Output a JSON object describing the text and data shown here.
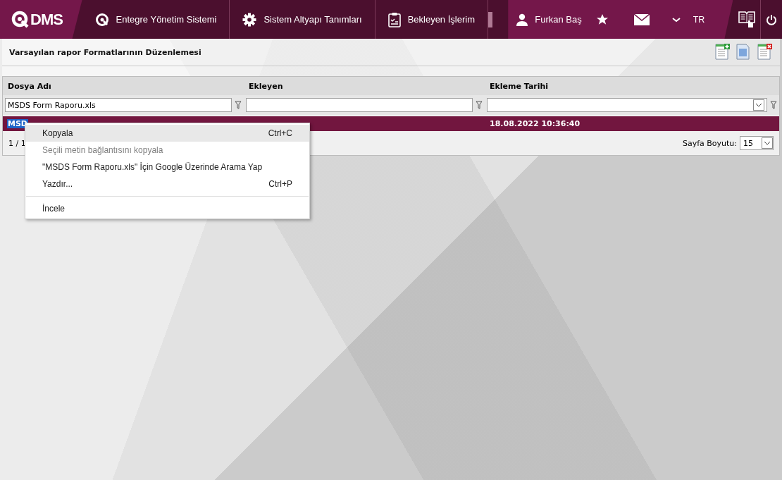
{
  "nav": {
    "logo": "DMS",
    "items": [
      {
        "label": "Entegre Yönetim Sistemi"
      },
      {
        "label": "Sistem Altyapı Tanımları"
      },
      {
        "label": "Bekleyen İşlerim"
      }
    ],
    "user": "Furkan Baş",
    "language": "TR"
  },
  "page": {
    "title": "Varsayılan rapor Formatlarının Düzenlemesi"
  },
  "table": {
    "columns": [
      {
        "label": "Dosya Adı",
        "filter": {
          "kind": "text",
          "value": "MSDS Form Raporu.xls"
        }
      },
      {
        "label": "Ekleyen",
        "filter": {
          "kind": "text"
        }
      },
      {
        "label": "Ekleme Tarihi",
        "filter": {
          "kind": "dropdown"
        }
      }
    ],
    "rows": [
      {
        "selected": true,
        "dosya_adi": "MSD",
        "dosya_adi_highlighted": true,
        "ekleme_tarihi": "18.08.2022 10:36:40"
      }
    ],
    "pager": {
      "pages": "1 / 1",
      "page_size_label": "Sayfa Boyutu:",
      "page_size": "15"
    }
  },
  "context_menu": {
    "items": [
      {
        "kind": "item",
        "label": "Kopyala",
        "shortcut": "Ctrl+C",
        "disabled": false,
        "selected": true
      },
      {
        "kind": "item",
        "label": "Seçili metin bağlantısını kopyala",
        "disabled": true,
        "selected": false
      },
      {
        "kind": "item",
        "label": "\"MSDS Form Raporu.xls\" İçin Google Üzerinde Arama Yap",
        "disabled": false,
        "selected": false
      },
      {
        "kind": "item",
        "label": "Yazdır...",
        "shortcut": "Ctrl+P",
        "disabled": false,
        "selected": false
      },
      {
        "kind": "separator"
      },
      {
        "kind": "item",
        "label": "İncele",
        "disabled": false,
        "selected": false
      }
    ]
  }
}
